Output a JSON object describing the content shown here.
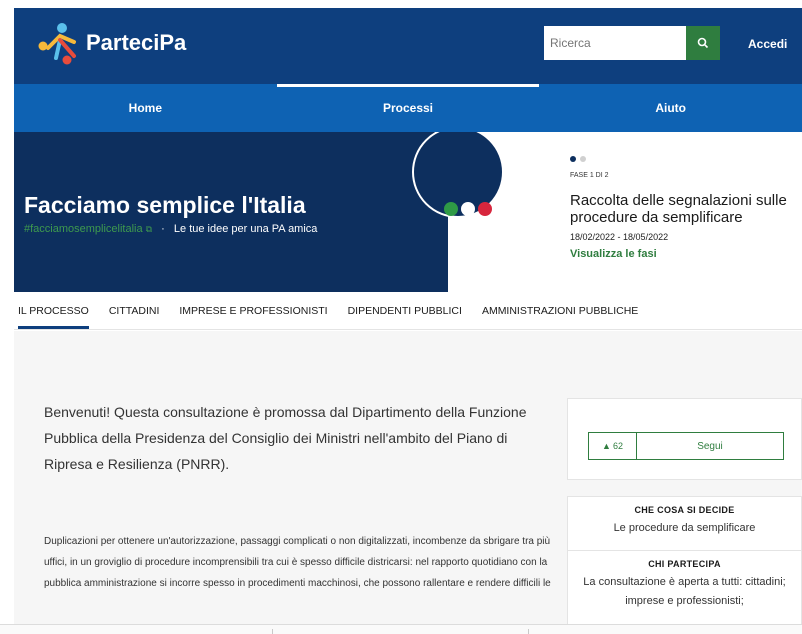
{
  "header": {
    "brand": "ParteciPa",
    "search_placeholder": "Ricerca",
    "login_label": "Accedi",
    "colors": {
      "header_bg": "#0e3f7e",
      "search_button": "#2f7d3f"
    }
  },
  "nav": {
    "items": [
      {
        "label": "Home"
      },
      {
        "label": "Processi",
        "active": true
      },
      {
        "label": "Aiuto"
      }
    ],
    "color": "#0e62b3"
  },
  "hero": {
    "title": "Facciamo semplice l'Italia",
    "hashtag": "#facciamosemplicelitalia",
    "separator": "·",
    "tagline": "Le tue idee per una PA amica",
    "dot_colors": [
      "#2f9a46",
      "#ffffff",
      "#d7263d"
    ],
    "bg_color": "#0d2f5e"
  },
  "phase": {
    "label": "FASE 1 DI 2",
    "title": "Raccolta delle segnalazioni sulle procedure da semplificare",
    "dates": "18/02/2022 - 18/05/2022",
    "link": "Visualizza le fasi"
  },
  "tabs": [
    {
      "label": "IL PROCESSO",
      "active": true
    },
    {
      "label": "CITTADINI"
    },
    {
      "label": "IMPRESE E PROFESSIONISTI"
    },
    {
      "label": "DIPENDENTI PUBBLICI"
    },
    {
      "label": "AMMINISTRAZIONI PUBBLICHE"
    }
  ],
  "main": {
    "lead": "Benvenuti! Questa consultazione è promossa dal Dipartimento della Funzione Pubblica della Presidenza del Consiglio dei Ministri nell'ambito del Piano di Ripresa e Resilienza (PNRR).",
    "body": "Duplicazioni per ottenere un'autorizzazione, passaggi complicati o non digitalizzati, incombenze da sbrigare tra più uffici, in un groviglio di procedure incomprensibili tra cui è spesso difficile districarsi: nel rapporto quotidiano con la pubblica amministrazione si incorre spesso in procedimenti macchinosi, che possono rallentare e rendere difficili le"
  },
  "sidebar": {
    "votes": "62",
    "follow_label": "Segui",
    "sections": [
      {
        "heading": "CHE COSA SI DECIDE",
        "value": "Le procedure da semplificare"
      },
      {
        "heading": "CHI PARTECIPA",
        "value": "La consultazione è aperta a tutti: cittadini; imprese e professionisti;"
      }
    ]
  }
}
